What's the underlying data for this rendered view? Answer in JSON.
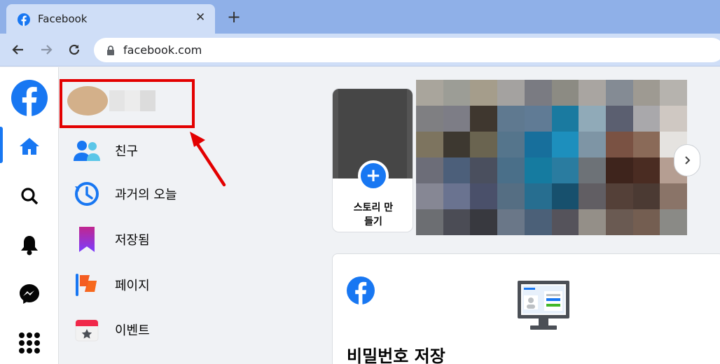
{
  "browser": {
    "tab_title": "Facebook",
    "close_glyph": "✕",
    "new_tab_glyph": "+",
    "url": "facebook.com",
    "icons": [
      "facebook-favicon",
      "back-arrow-icon",
      "forward-arrow-icon",
      "reload-icon",
      "lock-icon"
    ]
  },
  "rail": {
    "items": [
      "facebook-logo",
      "home-icon",
      "search-icon",
      "bell-icon",
      "messenger-icon",
      "menu-grid-icon"
    ],
    "active": "home-icon"
  },
  "sidebar": {
    "items": [
      {
        "label": "친구",
        "icon": "friends-icon"
      },
      {
        "label": "과거의 오늘",
        "icon": "memories-icon"
      },
      {
        "label": "저장됨",
        "icon": "saved-icon"
      },
      {
        "label": "페이지",
        "icon": "pages-icon"
      },
      {
        "label": "이벤트",
        "icon": "events-icon"
      }
    ]
  },
  "stories": {
    "create_label_line1": "스토리 만",
    "create_label_line2": "들기",
    "plus_glyph": "+"
  },
  "save_password": {
    "title": "비밀번호 저장"
  },
  "colors": {
    "brand": "#1877f2",
    "highlight": "#e30000",
    "tabbar": "#8fb0e8",
    "toolbar": "#cfdef7"
  }
}
